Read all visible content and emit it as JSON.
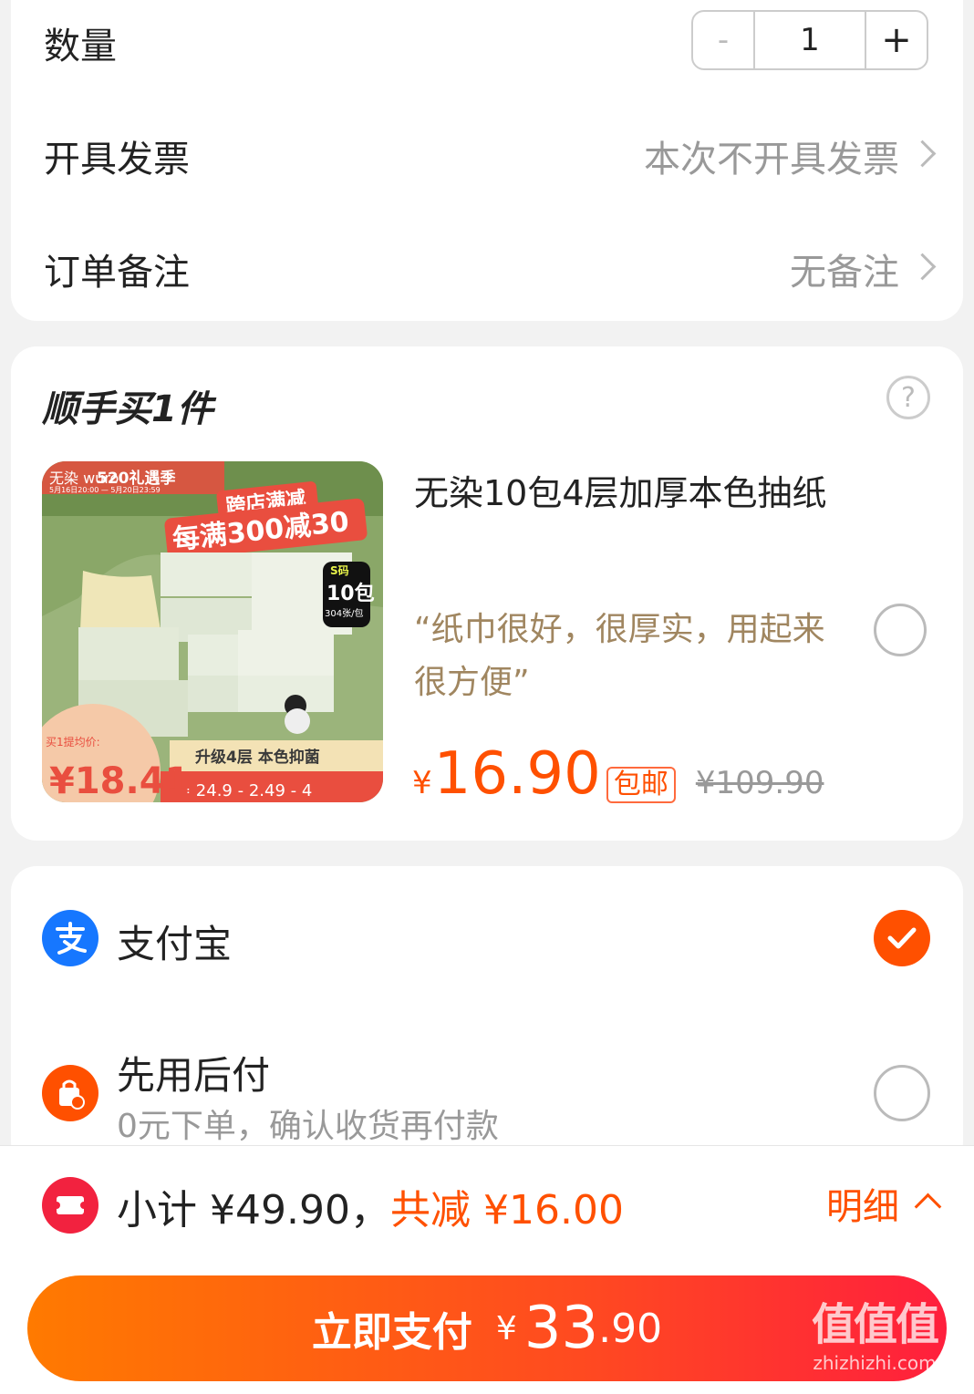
{
  "order": {
    "quantity_label": "数量",
    "quantity_value": "1",
    "minus": "-",
    "plus": "+",
    "invoice_label": "开具发票",
    "invoice_value": "本次不开具发票",
    "remark_label": "订单备注",
    "remark_value": "无备注"
  },
  "addon": {
    "title": "顺手买1件",
    "help": "?",
    "product": {
      "name": "无染10包4层加厚本色抽纸",
      "review_line1": "“纸巾很好，很厚实，用起来",
      "review_line2": "很方便”",
      "price_symbol": "¥",
      "price": "16.90",
      "badge": "包邮",
      "original_price": "¥109.90",
      "image": {
        "brand": "无染 wuro",
        "campaign": "520礼遇季",
        "dates": "5月16日20:00 — 5月20日23:59",
        "banner1": "跨店满减",
        "banner2": "每满300减30",
        "size": "S码",
        "packs": "10包",
        "sheets": "304张/包",
        "feature": "升级4层 本色抑菌",
        "calc_label": "买1提均价:",
        "calc_price": "¥18.41",
        "calc_formula": "= 24.9 - 2.49 - 4"
      }
    }
  },
  "payment": {
    "methods": [
      {
        "name": "支付宝",
        "icon": "alipay-icon",
        "selected": true
      },
      {
        "name": "先用后付",
        "sub": "0元下单，确认收货再付款",
        "icon": "pay-later-icon",
        "selected": false
      }
    ]
  },
  "bottom": {
    "subtotal": "小计 ¥49.90，",
    "discount": "共减 ¥16.00",
    "detail": "明细",
    "pay_label": "立即支付",
    "pay_symbol": "¥",
    "pay_int": "33",
    "pay_dec": ".90",
    "watermark": "值值值",
    "watermark_url": "zhizhizhi.com"
  },
  "colors": {
    "accent": "#ff5000",
    "review": "#a08660",
    "alipay": "#1677ff"
  }
}
